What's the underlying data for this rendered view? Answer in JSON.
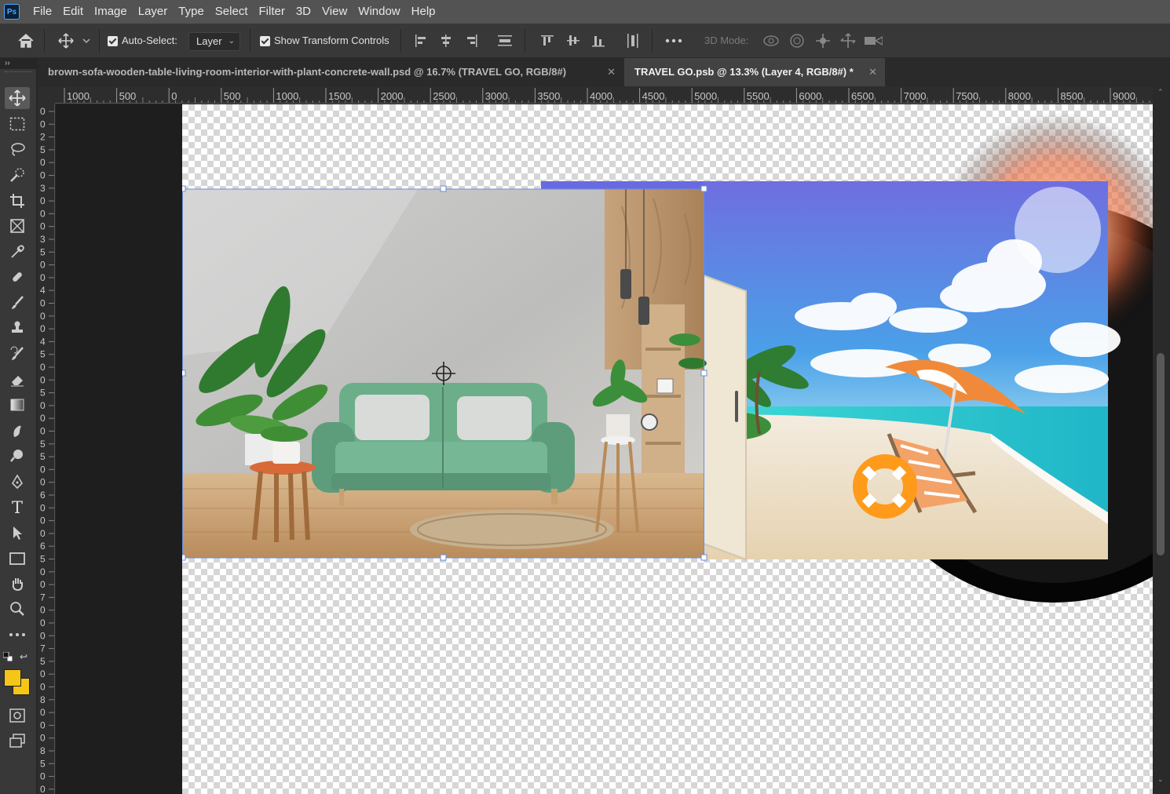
{
  "app": {
    "logo_text": "Ps"
  },
  "menu": [
    "File",
    "Edit",
    "Image",
    "Layer",
    "Type",
    "Select",
    "Filter",
    "3D",
    "View",
    "Window",
    "Help"
  ],
  "options": {
    "auto_select_label": "Auto-Select:",
    "auto_select_checked": true,
    "layer_dropdown": "Layer",
    "show_transform_label": "Show Transform Controls",
    "show_transform_checked": true,
    "three_d_mode_label": "3D Mode:"
  },
  "tabs": [
    {
      "label": "brown-sofa-wooden-table-living-room-interior-with-plant-concrete-wall.psd @ 16.7% (TRAVEL GO, RGB/8#)",
      "active": false
    },
    {
      "label": "TRAVEL GO.psb @ 13.3% (Layer 4, RGB/8#) *",
      "active": true
    }
  ],
  "ruler_top_labels": [
    "1000",
    "500",
    "0",
    "500",
    "1000",
    "1500",
    "2000",
    "2500",
    "3000",
    "3500",
    "4000",
    "4500",
    "5000",
    "5500",
    "6000",
    "6500",
    "7000",
    "7500",
    "8000",
    "8500",
    "9000"
  ],
  "ruler_left_labels": [
    "0",
    "0",
    "2",
    "5",
    "0",
    "0",
    "3",
    "0",
    "0",
    "0",
    "3",
    "5",
    "0",
    "0",
    "4",
    "0",
    "0",
    "0",
    "4",
    "5",
    "0",
    "0",
    "5",
    "0",
    "0",
    "0",
    "5",
    "5",
    "0",
    "0",
    "6",
    "0",
    "0",
    "0",
    "6",
    "5",
    "0",
    "0",
    "7",
    "0",
    "0",
    "0",
    "7",
    "5",
    "0",
    "0",
    "8",
    "0",
    "0",
    "0",
    "8",
    "5",
    "0",
    "0"
  ],
  "tools": [
    "move-tool-icon",
    "marquee-tool-icon",
    "lasso-tool-icon",
    "quick-select-tool-icon",
    "crop-tool-icon",
    "frame-tool-icon",
    "eyedropper-tool-icon",
    "healing-brush-tool-icon",
    "brush-tool-icon",
    "stamp-tool-icon",
    "history-brush-tool-icon",
    "eraser-tool-icon",
    "gradient-tool-icon",
    "smudge-tool-icon",
    "dodge-tool-icon",
    "pen-tool-icon",
    "type-tool-icon",
    "path-select-tool-icon",
    "rectangle-tool-icon",
    "hand-tool-icon",
    "zoom-tool-icon",
    "more-tools-icon"
  ],
  "colors": {
    "foreground": "#f5c518",
    "background": "#f5c518",
    "accent": "#4fa8ff",
    "transform_box": "#6a8fd8"
  }
}
